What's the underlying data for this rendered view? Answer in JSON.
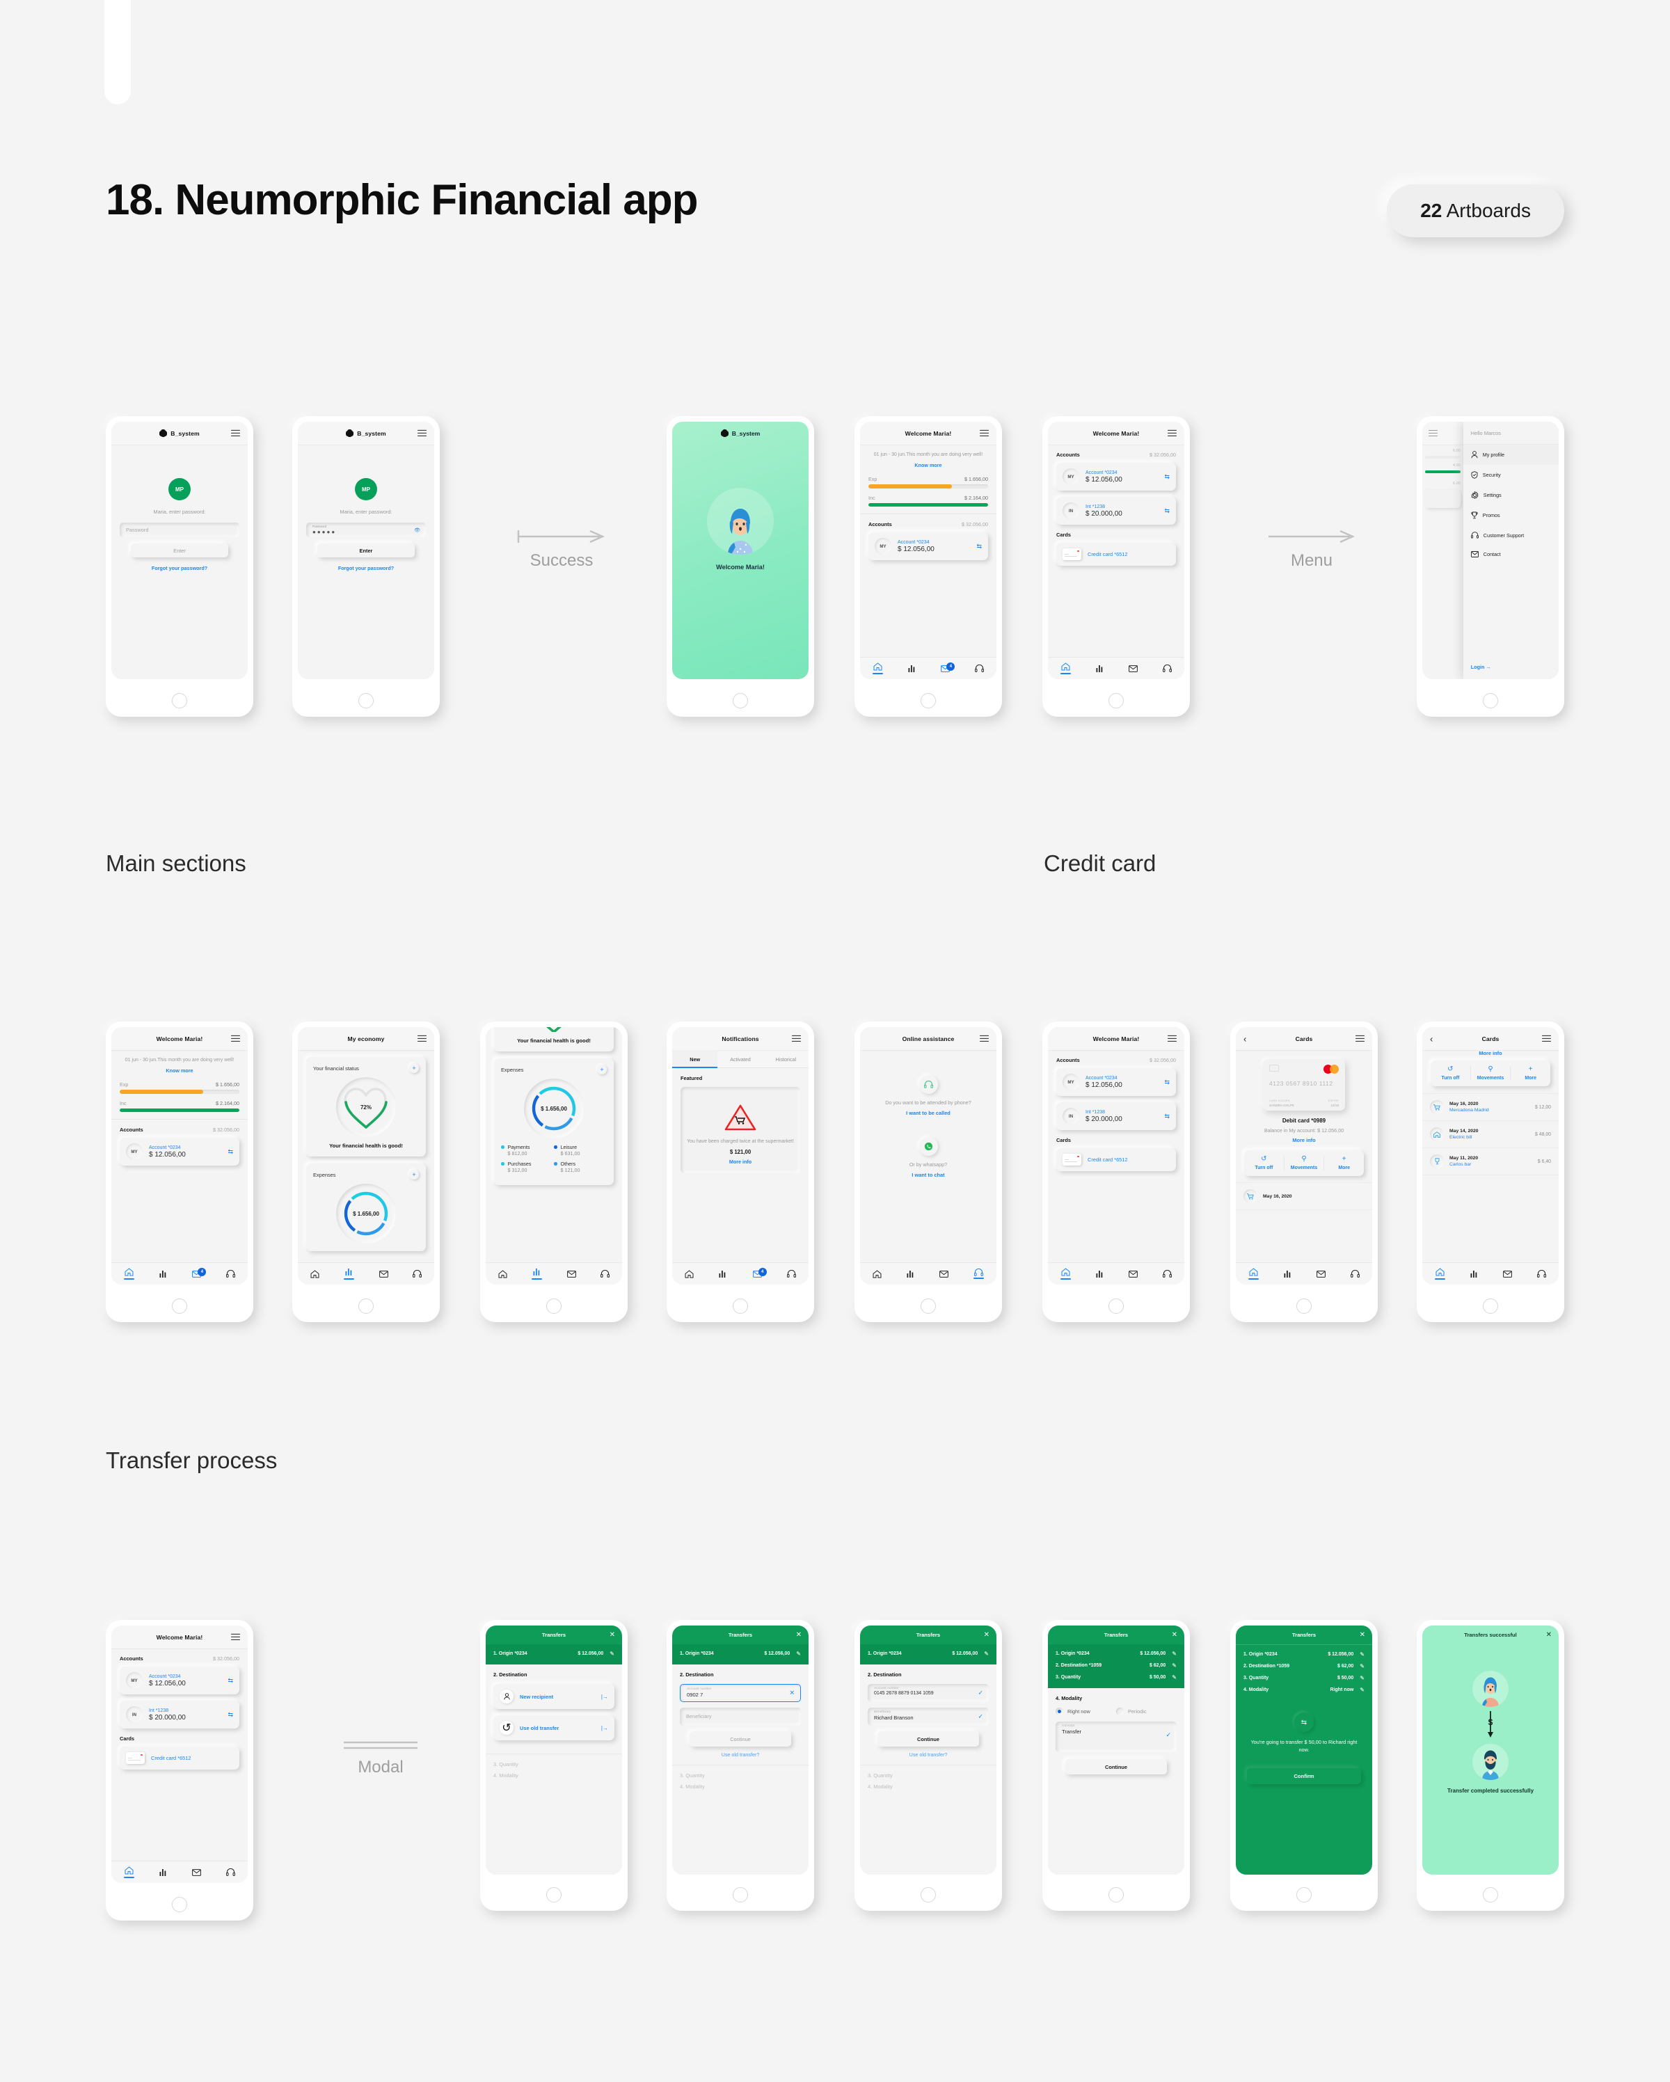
{
  "page": {
    "title": "18. Neumorphic Financial app",
    "artboards_count": "22",
    "artboards_label": "Artboards",
    "sections": [
      {
        "id": "main-sections",
        "label": "Main sections"
      },
      {
        "id": "credit-card",
        "label": "Credit card"
      },
      {
        "id": "transfer-process",
        "label": "Transfer process"
      }
    ],
    "connectors": [
      {
        "id": "success",
        "label": "Success"
      },
      {
        "id": "menu",
        "label": "Menu"
      },
      {
        "id": "modal",
        "label": "Modal"
      }
    ]
  },
  "colors": {
    "brand_green": "#0e9c58",
    "accent_blue": "#1a86f5",
    "expense_orange": "#f5a623",
    "income_green": "#00a85a",
    "mint": "#9aefc8",
    "background": "#f4f4f4"
  },
  "login": {
    "app_name": "B_system",
    "avatar_initials": "MP",
    "prompt": "Maria, enter password:",
    "password_placeholder": "Password",
    "password_value": "●●●●●",
    "enter_label": "Enter",
    "forgot_label": "Forgot your password?"
  },
  "splash": {
    "app_name": "B_system",
    "welcome": "Welcome Maria!"
  },
  "dashboard": {
    "title": "Welcome Maria!",
    "period_text": "01 jun - 30 jun.This month you are doing very well!",
    "know_more": "Know more",
    "expense_label": "Exp",
    "expense_value": "$ 1.656,00",
    "income_label": "Inc",
    "income_value": "$ 2.164,00",
    "accounts_label": "Accounts",
    "accounts_total": "$ 32.056,00",
    "accounts": [
      {
        "initials": "MY",
        "name": "Account *0234",
        "balance": "$ 12.056,00"
      },
      {
        "initials": "IN",
        "name": "Int *1238",
        "balance": "$ 20.000,00"
      }
    ],
    "cards_label": "Cards",
    "cards": [
      {
        "name": "Credit card  *6512"
      }
    ],
    "tabbar": [
      {
        "icon": "home-icon",
        "active": true
      },
      {
        "icon": "chart-icon",
        "active": false
      },
      {
        "icon": "mail-icon",
        "active": false,
        "badge": "4"
      },
      {
        "icon": "headset-icon",
        "active": false
      }
    ]
  },
  "menu": {
    "greeting": "Hello Marcos",
    "items": [
      {
        "icon": "user-icon",
        "label": "My profile",
        "active": true
      },
      {
        "icon": "shield-icon",
        "label": "Security",
        "active": false
      },
      {
        "icon": "gear-icon",
        "label": "Settings",
        "active": false
      },
      {
        "icon": "trophy-icon",
        "label": "Promos",
        "active": false
      },
      {
        "icon": "headset-icon",
        "label": "Customer Support",
        "active": false
      },
      {
        "icon": "mail-icon",
        "label": "Contact",
        "active": false
      }
    ],
    "login_label": "Login"
  },
  "economy": {
    "title": "My economy",
    "status_card_title": "Your financial status",
    "health_percent": "72%",
    "health_message": "Your financial health is good!",
    "expenses_card_title": "Expenses",
    "expenses_total": "$ 1.656,00",
    "legend": [
      {
        "label": "Payments",
        "amount": "$ 812,00",
        "color": "#22c7e8"
      },
      {
        "label": "Leisure",
        "amount": "$ 631,00",
        "color": "#1266d8"
      },
      {
        "label": "Purchases",
        "amount": "$ 312,00",
        "color": "#19cfe0"
      },
      {
        "label": "Others",
        "amount": "$ 121,00",
        "color": "#2f9ae8"
      }
    ]
  },
  "notifications": {
    "title": "Notifications",
    "tabs": [
      {
        "label": "New",
        "active": true
      },
      {
        "label": "Activated",
        "active": false
      },
      {
        "label": "Historical",
        "active": false
      }
    ],
    "featured_label": "Featured",
    "alert_icon": "cart-warning-icon",
    "alert_text": "You have been charged twice at the supermarket!",
    "alert_amount": "$ 121,00",
    "more_info": "More info"
  },
  "assistance": {
    "title": "Online assistance",
    "phone_question": "Do you want to be attended by phone?",
    "phone_action": "I want to be called",
    "whatsapp_question": "Or by whatsapp?",
    "whatsapp_action": "I want to chat"
  },
  "card_detail": {
    "title": "Cards",
    "card_number": "4123  0567  8910  1112",
    "holder_label": "CARD HOLDER",
    "holder_value": "SANDRA GOLPE",
    "expire_label": "EXPIRE",
    "expire_value": "12/19",
    "card_name": "Debit card *0989",
    "balance_text": "Balance in My account: $ 12.056,00",
    "more_info": "More info",
    "actions": [
      {
        "icon": "refresh-icon",
        "label": "Turn off"
      },
      {
        "icon": "search-icon",
        "label": "Movements"
      },
      {
        "icon": "plus-icon",
        "label": "More"
      }
    ],
    "movements": [
      {
        "icon": "cart-icon",
        "date": "May 16, 2020",
        "desc": "Mercadona Madrid",
        "amount": "$ 12,00"
      },
      {
        "icon": "home-icon",
        "date": "May 14, 2020",
        "desc": "Electric bill",
        "amount": "$ 48,00"
      },
      {
        "icon": "trophy-icon",
        "date": "May 11, 2020",
        "desc": "Carlos bar",
        "amount": "$ 6,40"
      }
    ]
  },
  "transfer": {
    "title": "Transfers",
    "success_title": "Transfers successful",
    "origin_label": "1. Origin *0234",
    "origin_amount": "$ 12.056,00",
    "destination_label": "2. Destination",
    "destination_done_label": "2. Destination *1059",
    "destination_amount": "$ 62,00",
    "quantity_label": "3. Quantity",
    "quantity_amount": "$ 50,00",
    "modality_label": "4. Modality",
    "modality_value": "Right now",
    "new_recipient": "New recipient",
    "use_old_transfer": "Use old transfer",
    "account_field_label": "Account number",
    "account_typing_value": "0902 7",
    "account_full_value": "0145 2678 8879 0134 1059",
    "beneficiary_label": "Beneficiary",
    "beneficiary_value": "Richard Branson",
    "continue_label": "Continue",
    "use_old_transfer_q": "Use old transfer?",
    "radio_now": "Right now",
    "radio_periodic": "Periodic",
    "concept_label": "Concept",
    "concept_value": "Transfer",
    "confirm_text": "You're going to transfer $ 50,00 to Richard right now.",
    "confirm_label": "Confirm",
    "completed_text": "Transfer completed successfully"
  }
}
